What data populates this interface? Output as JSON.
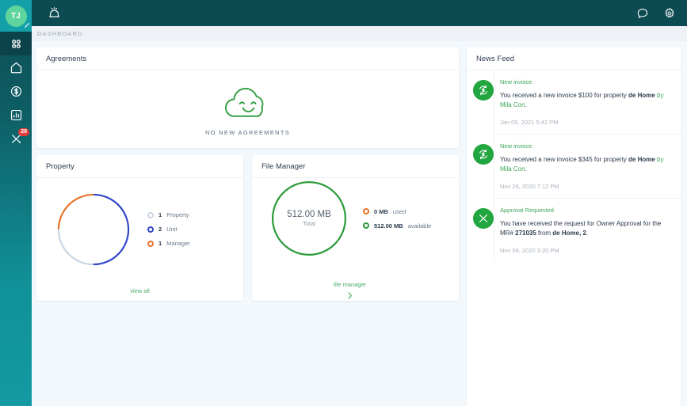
{
  "sidebar": {
    "avatar_initials": "TJ",
    "items": [
      {
        "name": "apps",
        "icon": "grid-apps-icon",
        "active": true,
        "badge": ""
      },
      {
        "name": "home",
        "icon": "home-icon",
        "active": false,
        "badge": ""
      },
      {
        "name": "accounting",
        "icon": "dollar-circle-icon",
        "active": false,
        "badge": ""
      },
      {
        "name": "reports",
        "icon": "bar-chart-icon",
        "active": false,
        "badge": ""
      },
      {
        "name": "maintenance",
        "icon": "tools-icon",
        "active": false,
        "badge": "28"
      }
    ]
  },
  "topbar": {
    "alarm_icon": "siren-alarm-icon",
    "chat_icon": "chat-bubble-icon",
    "settings_icon": "gear-icon"
  },
  "breadcrumb": {
    "label": "DASHBOARD"
  },
  "agreements": {
    "title": "Agreements",
    "empty_icon": "smiling-cloud-icon",
    "empty_text": "NO NEW AGREEMENTS"
  },
  "property": {
    "title": "Property",
    "footer_link": "view all",
    "legend": [
      {
        "count": "1",
        "label": "Property",
        "color": "#c8d4e3",
        "percent": 25
      },
      {
        "count": "2",
        "label": "Unit",
        "color": "#2f46c9",
        "percent": 50
      },
      {
        "count": "1",
        "label": "Manager",
        "color": "#e8732a",
        "percent": 25
      }
    ]
  },
  "file_manager": {
    "title": "File Manager",
    "center_value": "512.00 MB",
    "center_label": "Total",
    "ring_color": "#2d9c3c",
    "footer_link": "file manager",
    "footer_chevron": "chevron-right-icon",
    "legend": [
      {
        "count": "0 MB",
        "label": "used",
        "color": "#e8732a"
      },
      {
        "count": "512.00 MB",
        "label": "available",
        "color": "#2d9c3c"
      }
    ]
  },
  "news_feed": {
    "title": "News Feed",
    "items": [
      {
        "icon": "invoice-refresh-icon",
        "type": "New invoice",
        "text_1": "You received a new invoice $100 for property ",
        "bold_1": "de Home",
        "text_green": " by Mila Con",
        "text_end": ".",
        "time": "Jan 05, 2021 5:42 PM"
      },
      {
        "icon": "invoice-refresh-icon",
        "type": "New invoice",
        "text_1": "You received a new invoice $345 for property ",
        "bold_1": "de Home",
        "text_green": " by Mila Con",
        "text_end": ".",
        "time": "Nov 26, 2020 7:12 PM"
      },
      {
        "icon": "tools-circle-icon",
        "type": "Approval Requested",
        "text_1": "You have received the request for Owner Approval for the MR# ",
        "bold_1": "271035",
        "text_green": "",
        "text_mid": " from ",
        "bold_2": "de Home, 2",
        "text_end": ".",
        "time": "Nov 06, 2020 3:20 PM"
      }
    ]
  },
  "colors": {
    "sidebar_top": "#0d4c52",
    "sidebar_bottom": "#139aa2",
    "topbar": "#0d4b52",
    "accent_green": "#3fa659",
    "badge_red": "#ea3b3b",
    "page_bg": "#f3f8fc"
  }
}
